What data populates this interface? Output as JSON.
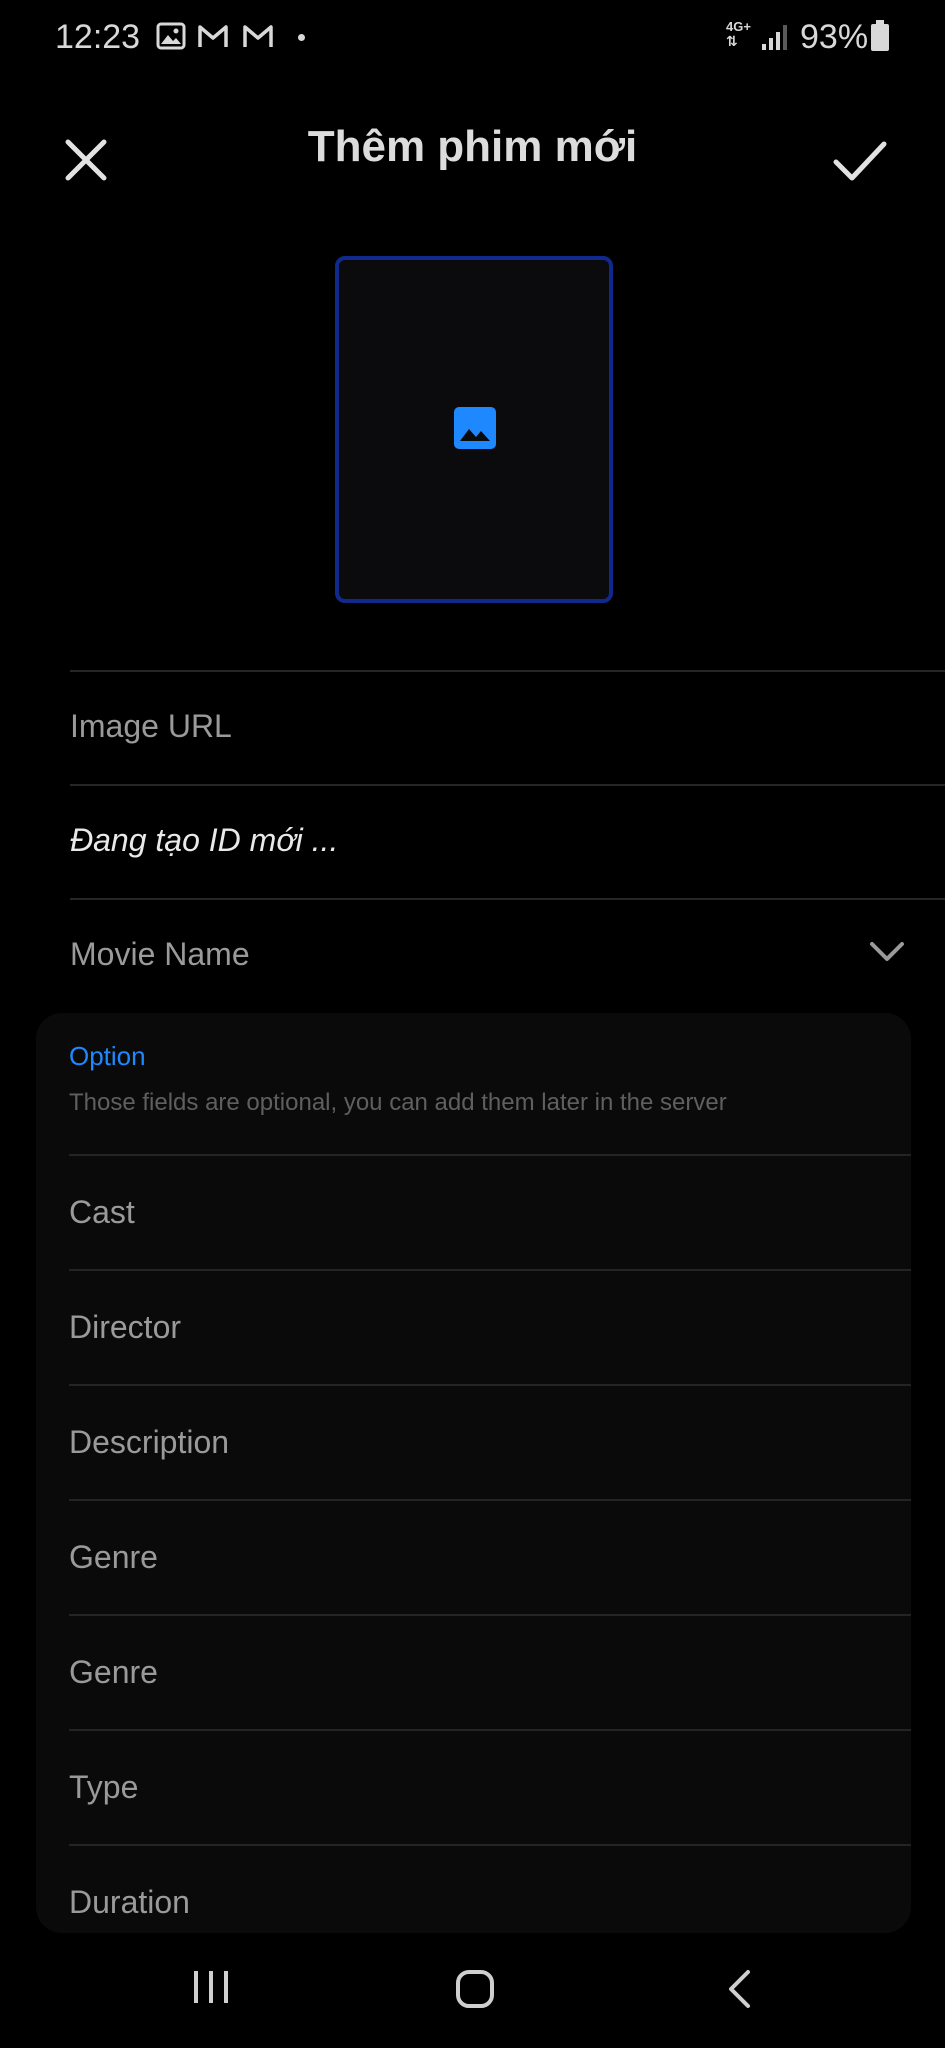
{
  "status_bar": {
    "time": "12:23",
    "notification_icons": [
      "gallery-icon",
      "gmail-icon",
      "gmail-icon"
    ],
    "network": "4G+",
    "battery": "93%"
  },
  "header": {
    "title": "Thêm phim mới",
    "close_icon": "close-icon",
    "confirm_icon": "check-icon"
  },
  "image_picker": {
    "icon": "image-icon",
    "accent": "#1e88ff",
    "border_color": "#0f2a8c"
  },
  "form": {
    "image_url": {
      "placeholder": "Image URL"
    },
    "id_status": "Đang tạo ID mới ...",
    "movie_name": {
      "placeholder": "Movie Name"
    }
  },
  "option_section": {
    "title": "Option",
    "subtitle": "Those fields are optional, you can add them later in the server",
    "fields": [
      "Cast",
      "Director",
      "Description",
      "Genre",
      "Genre",
      "Type",
      "Duration"
    ]
  },
  "nav_bar": {
    "recent_icon": "recent-apps-icon",
    "home_icon": "home-icon",
    "back_icon": "back-icon"
  }
}
